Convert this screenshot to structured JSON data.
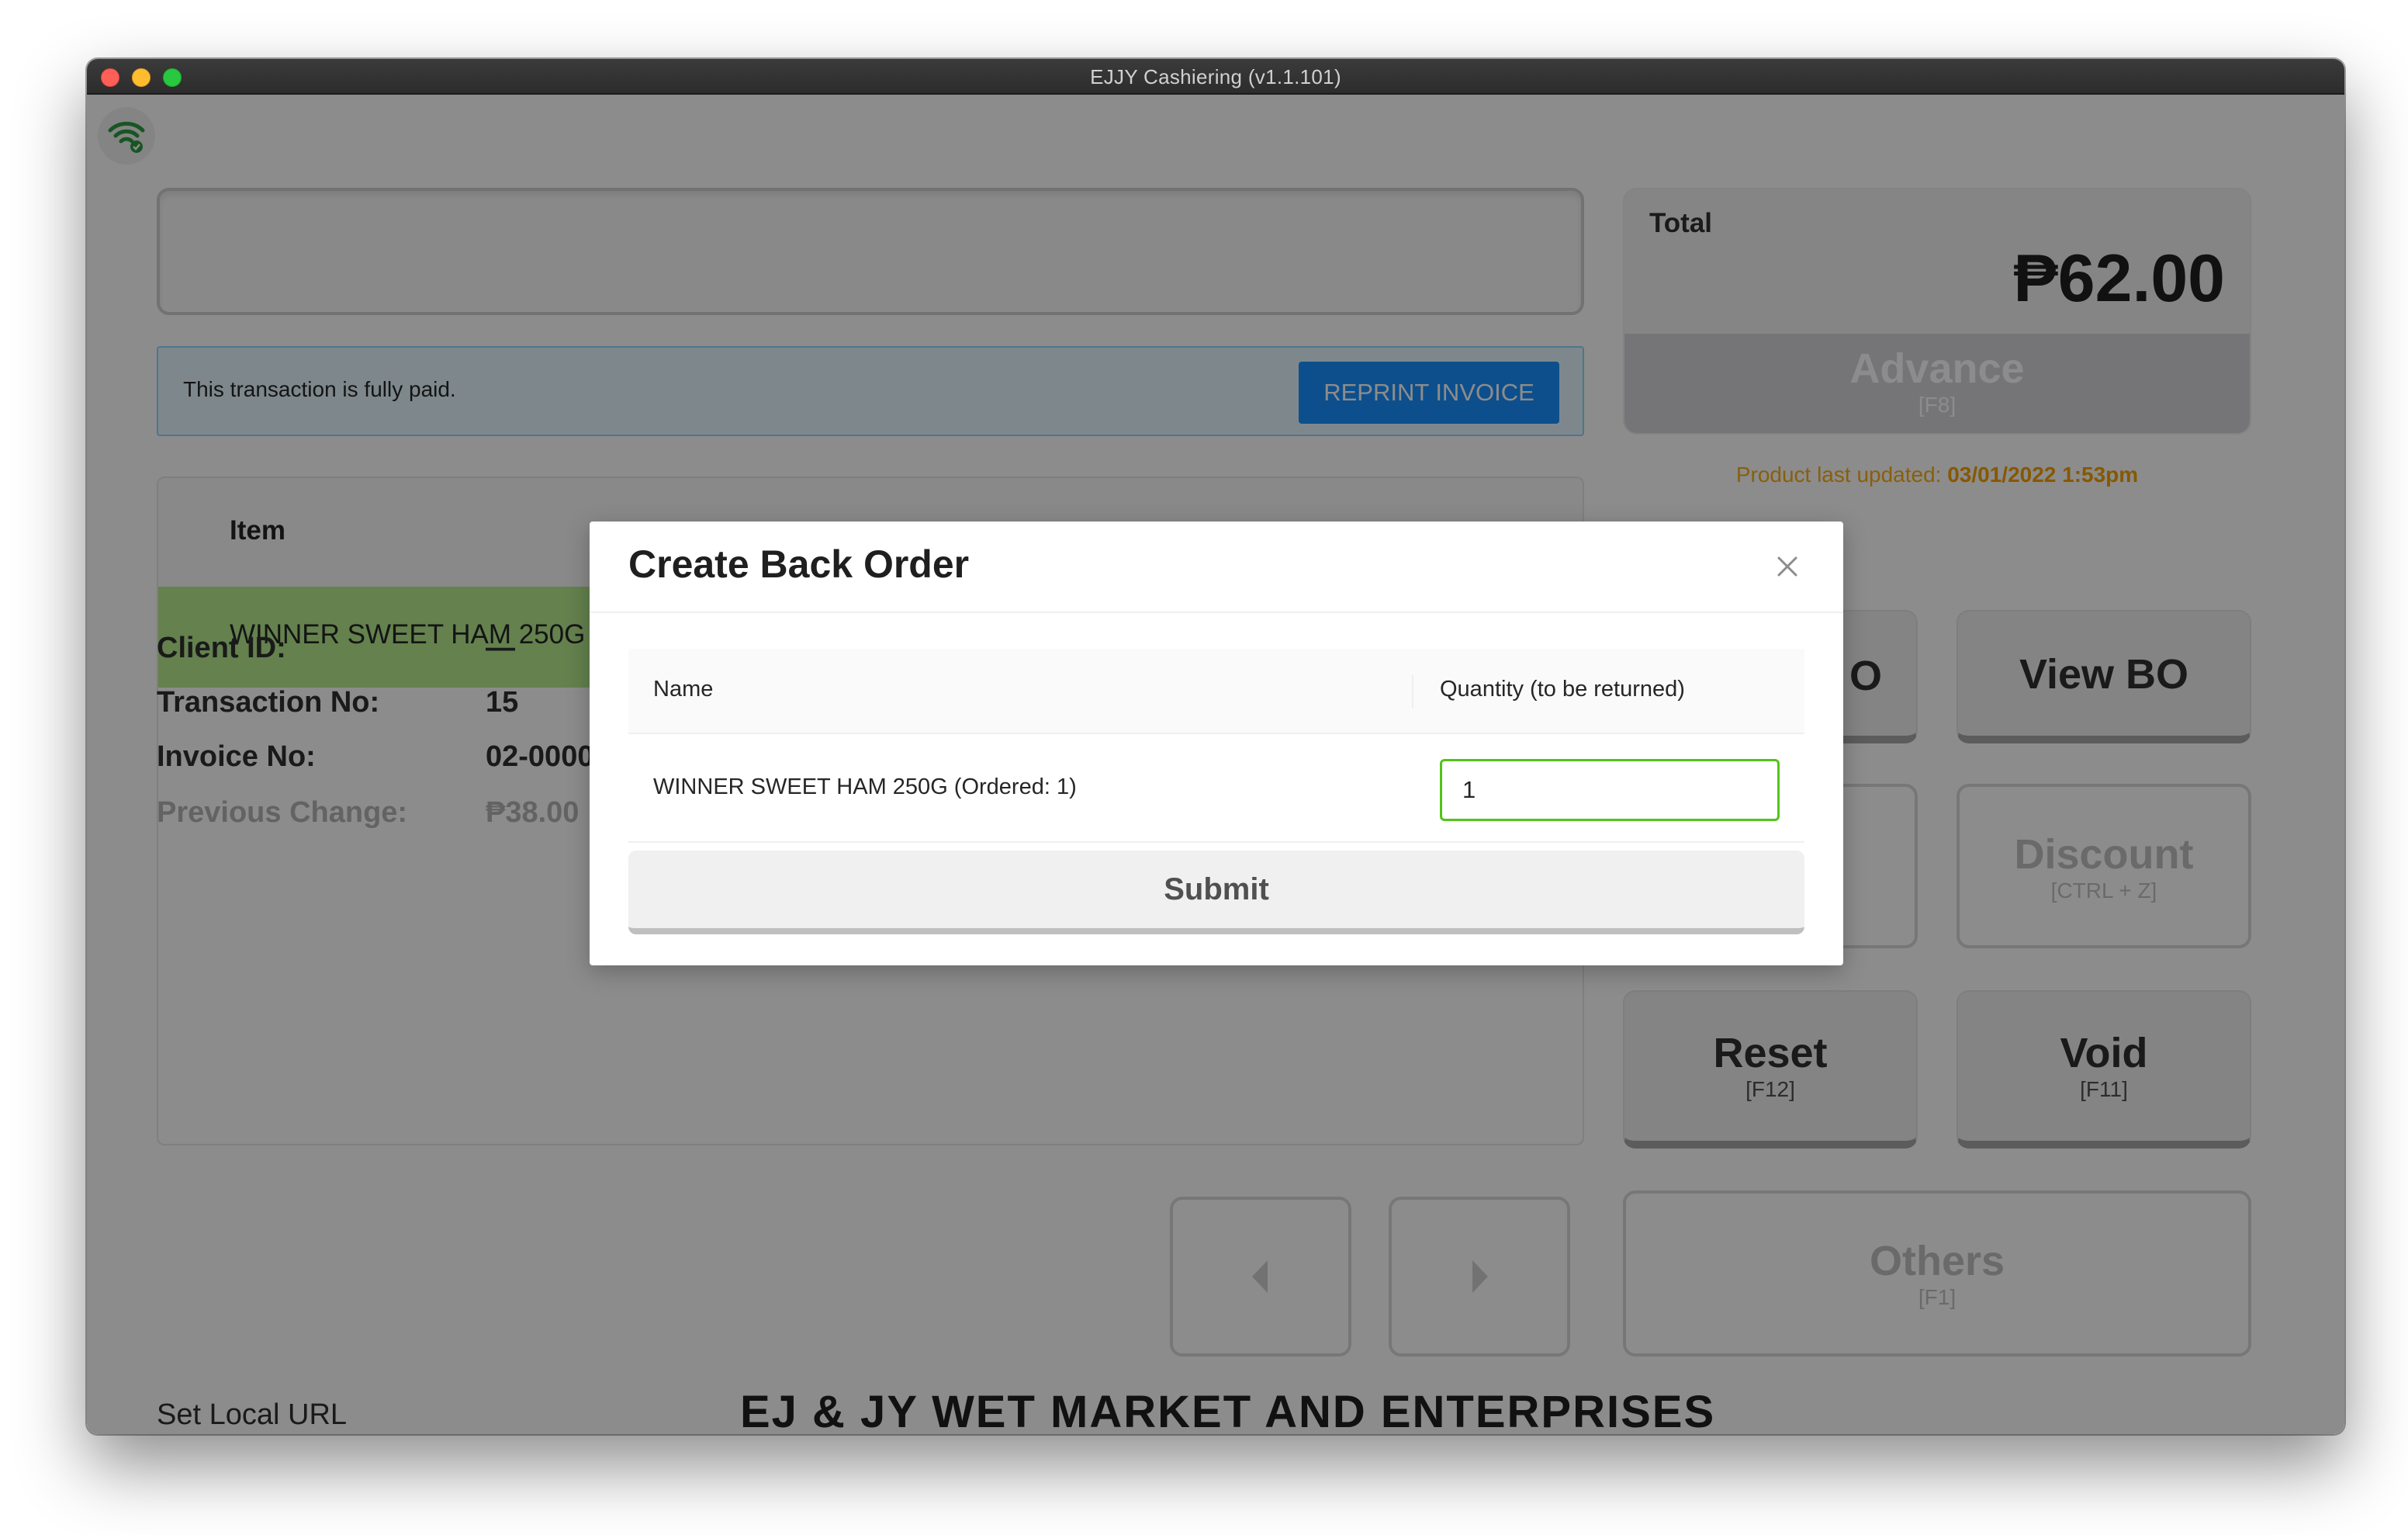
{
  "window": {
    "title": "EJJY Cashiering (v1.1.101)"
  },
  "status": {
    "connection_icon": "wifi-connected-icon"
  },
  "payment_alert": {
    "message": "This transaction is fully paid.",
    "reprint_label": "REPRINT INVOICE"
  },
  "items_table": {
    "column_item": "Item",
    "rows": [
      {
        "name": "WINNER SWEET HAM 250G"
      }
    ]
  },
  "transaction_info": {
    "client_id_label": "Client ID:",
    "client_id_value": "—",
    "transaction_no_label": "Transaction No:",
    "transaction_no_value": "15",
    "invoice_no_label": "Invoice No:",
    "invoice_no_value": "02-000003",
    "previous_change_label": "Previous Change:",
    "previous_change_value": "₱38.00"
  },
  "footer": {
    "set_local_url": "Set Local URL",
    "store_name": "EJ & JY WET MARKET AND ENTERPRISES"
  },
  "totals": {
    "label": "Total",
    "amount": "₱62.00",
    "advance_label": "Advance",
    "advance_key": "[F8]",
    "product_updated_label": "Product last updated:",
    "product_updated_value": "03/01/2022 1:53pm"
  },
  "actions": {
    "create_bo_label_visible": "O",
    "view_bo_label": "View BO",
    "discount_label": "Discount",
    "discount_key": "[CTRL + Z]",
    "reset_label": "Reset",
    "reset_key": "[F12]",
    "void_label": "Void",
    "void_key": "[F11]",
    "others_label": "Others",
    "others_key": "[F1]"
  },
  "modal": {
    "title": "Create Back Order",
    "col_name": "Name",
    "col_quantity": "Quantity (to be returned)",
    "rows": [
      {
        "name": "WINNER SWEET HAM 250G (Ordered: 1)",
        "quantity": "1"
      }
    ],
    "submit_label": "Submit"
  },
  "colors": {
    "primary": "#1890ff",
    "paid_row": "#b7eb8f",
    "warning": "#faad14",
    "input_valid": "#52c41a"
  }
}
